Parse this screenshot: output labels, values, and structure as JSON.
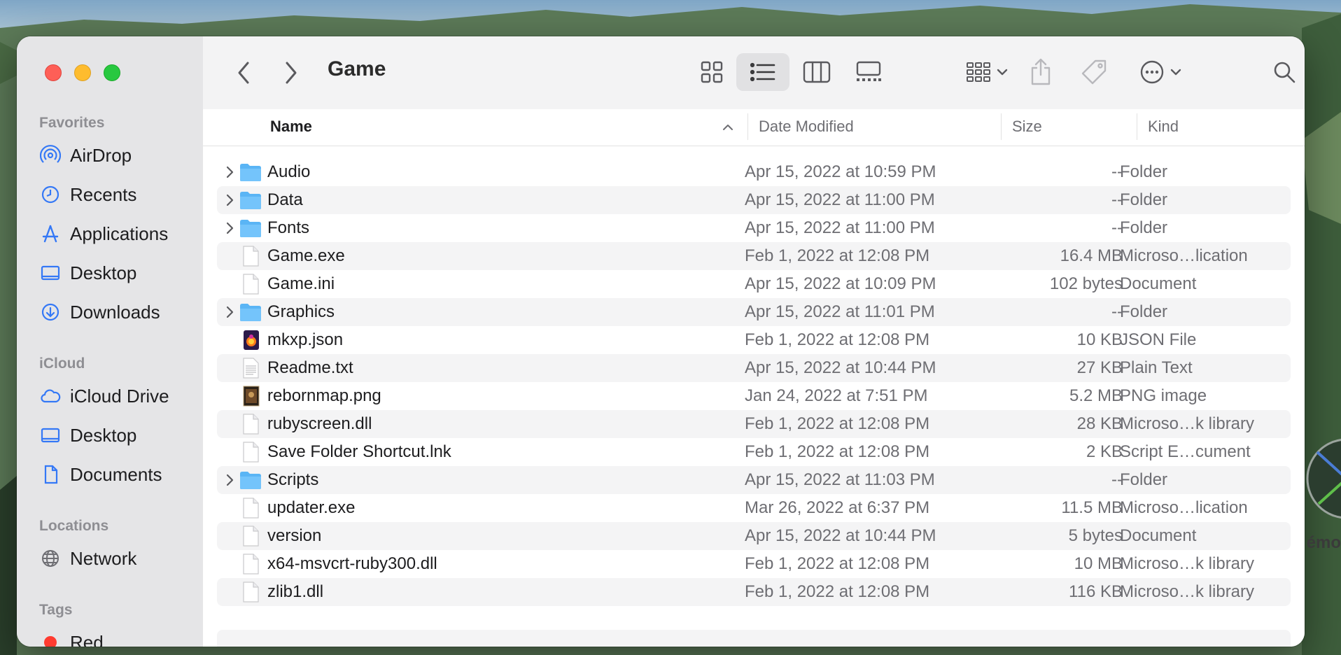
{
  "window": {
    "title": "Game"
  },
  "sidebar": {
    "sections": [
      {
        "label": "Favorites",
        "items": [
          {
            "label": "AirDrop",
            "icon": "airdrop-icon"
          },
          {
            "label": "Recents",
            "icon": "clock-icon"
          },
          {
            "label": "Applications",
            "icon": "applications-icon"
          },
          {
            "label": "Desktop",
            "icon": "desktop-icon"
          },
          {
            "label": "Downloads",
            "icon": "downloads-icon"
          }
        ]
      },
      {
        "label": "iCloud",
        "items": [
          {
            "label": "iCloud Drive",
            "icon": "cloud-icon"
          },
          {
            "label": "Desktop",
            "icon": "desktop-icon"
          },
          {
            "label": "Documents",
            "icon": "document-icon"
          }
        ]
      },
      {
        "label": "Locations",
        "items": [
          {
            "label": "Network",
            "icon": "globe-icon"
          }
        ]
      },
      {
        "label": "Tags",
        "items": [
          {
            "label": "Red",
            "icon": "red-tag-dot",
            "color": "#ff3b30"
          }
        ]
      }
    ]
  },
  "columns": {
    "name": "Name",
    "date": "Date Modified",
    "size": "Size",
    "kind": "Kind"
  },
  "files": [
    {
      "name": "Audio",
      "date": "Apr 15, 2022 at 10:59 PM",
      "size": "--",
      "kind": "Folder",
      "type": "folder"
    },
    {
      "name": "Data",
      "date": "Apr 15, 2022 at 11:00 PM",
      "size": "--",
      "kind": "Folder",
      "type": "folder"
    },
    {
      "name": "Fonts",
      "date": "Apr 15, 2022 at 11:00 PM",
      "size": "--",
      "kind": "Folder",
      "type": "folder"
    },
    {
      "name": "Game.exe",
      "date": "Feb 1, 2022 at 12:08 PM",
      "size": "16.4 MB",
      "kind": "Microso…lication",
      "type": "file"
    },
    {
      "name": "Game.ini",
      "date": "Apr 15, 2022 at 10:09 PM",
      "size": "102 bytes",
      "kind": "Document",
      "type": "file"
    },
    {
      "name": "Graphics",
      "date": "Apr 15, 2022 at 11:01 PM",
      "size": "--",
      "kind": "Folder",
      "type": "folder"
    },
    {
      "name": "mkxp.json",
      "date": "Feb 1, 2022 at 12:08 PM",
      "size": "10 KB",
      "kind": "JSON File",
      "type": "json"
    },
    {
      "name": "Readme.txt",
      "date": "Apr 15, 2022 at 10:44 PM",
      "size": "27 KB",
      "kind": "Plain Text",
      "type": "text"
    },
    {
      "name": "rebornmap.png",
      "date": "Jan 24, 2022 at 7:51 PM",
      "size": "5.2 MB",
      "kind": "PNG image",
      "type": "image"
    },
    {
      "name": "rubyscreen.dll",
      "date": "Feb 1, 2022 at 12:08 PM",
      "size": "28 KB",
      "kind": "Microso…k library",
      "type": "file"
    },
    {
      "name": "Save Folder Shortcut.lnk",
      "date": "Feb 1, 2022 at 12:08 PM",
      "size": "2 KB",
      "kind": "Script E…cument",
      "type": "file"
    },
    {
      "name": "Scripts",
      "date": "Apr 15, 2022 at 11:03 PM",
      "size": "--",
      "kind": "Folder",
      "type": "folder"
    },
    {
      "name": "updater.exe",
      "date": "Mar 26, 2022 at 6:37 PM",
      "size": "11.5 MB",
      "kind": "Microso…lication",
      "type": "file"
    },
    {
      "name": "version",
      "date": "Apr 15, 2022 at 10:44 PM",
      "size": "5 bytes",
      "kind": "Document",
      "type": "file"
    },
    {
      "name": "x64-msvcrt-ruby300.dll",
      "date": "Feb 1, 2022 at 12:08 PM",
      "size": "10 MB",
      "kind": "Microso…k library",
      "type": "file"
    },
    {
      "name": "zlib1.dll",
      "date": "Feb 1, 2022 at 12:08 PM",
      "size": "116 KB",
      "kind": "Microso…k library",
      "type": "file"
    }
  ],
  "desktop_peek_text": "émo"
}
